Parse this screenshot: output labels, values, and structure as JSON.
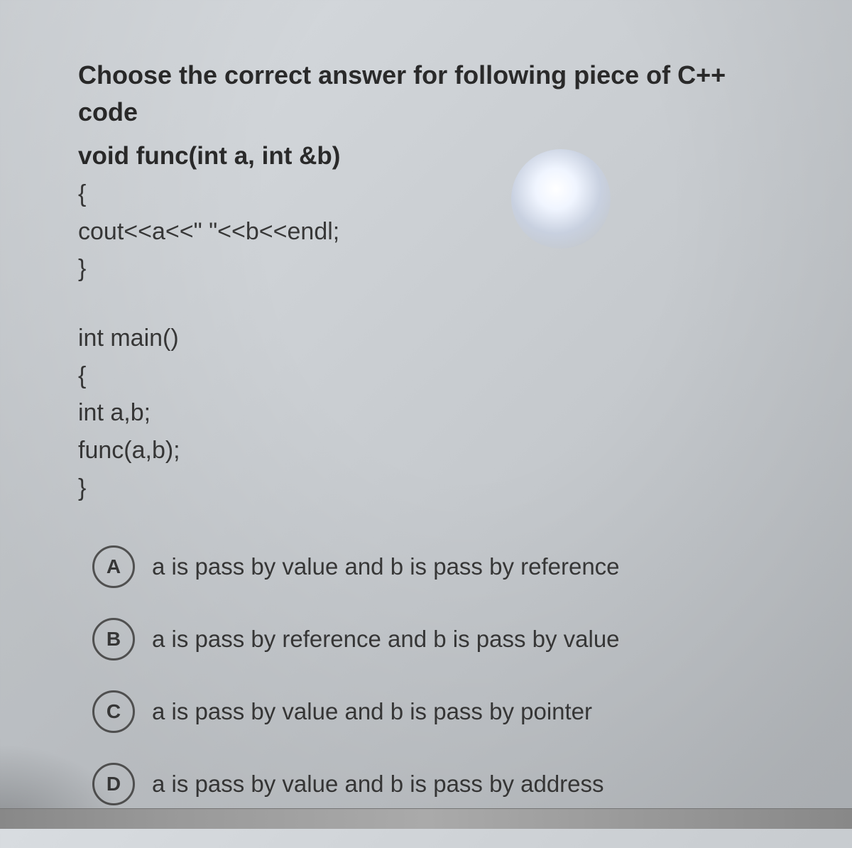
{
  "question": {
    "title": "Choose the correct answer for following piece of C++ code",
    "code_func_sig": "void func(int a, int &b)",
    "code_func_open": "{",
    "code_func_body": "cout<<a<<\" \"<<b<<endl;",
    "code_func_close": "}",
    "code_main_sig": "int main()",
    "code_main_open": "{",
    "code_main_decl": "int a,b;",
    "code_main_call": "func(a,b);",
    "code_main_close": "}"
  },
  "options": [
    {
      "letter": "A",
      "text": "a is pass by value and b is pass by reference"
    },
    {
      "letter": "B",
      "text": "a is pass by reference and b is pass by value"
    },
    {
      "letter": "C",
      "text": "a is pass by value and b is pass by pointer"
    },
    {
      "letter": "D",
      "text": "a is pass by value and b is pass by address"
    }
  ]
}
